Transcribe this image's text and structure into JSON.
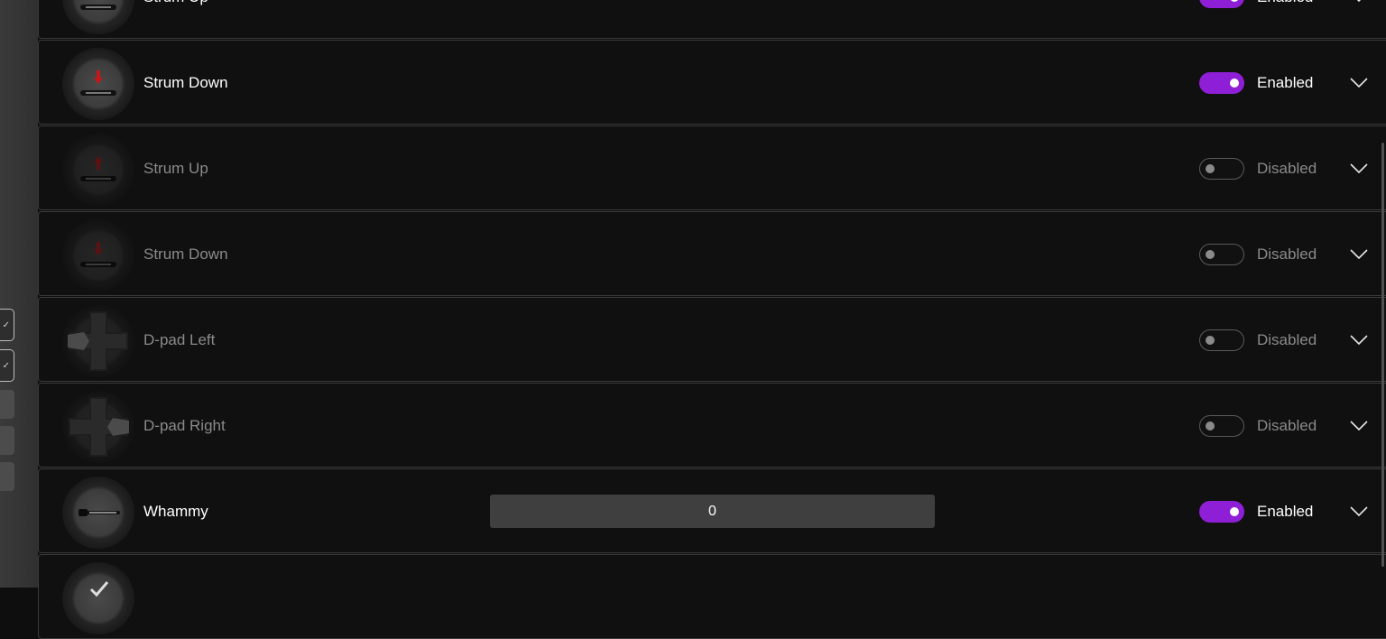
{
  "rows": [
    {
      "label": "Strum Up",
      "status": "Enabled",
      "enabled": true,
      "icon": "strum-up"
    },
    {
      "label": "Strum Down",
      "status": "Enabled",
      "enabled": true,
      "icon": "strum-down"
    },
    {
      "label": "Strum Up",
      "status": "Disabled",
      "enabled": false,
      "icon": "strum-up"
    },
    {
      "label": "Strum Down",
      "status": "Disabled",
      "enabled": false,
      "icon": "strum-down"
    },
    {
      "label": "D-pad Left",
      "status": "Disabled",
      "enabled": false,
      "icon": "dpad-left"
    },
    {
      "label": "D-pad Right",
      "status": "Disabled",
      "enabled": false,
      "icon": "dpad-right"
    },
    {
      "label": "Whammy",
      "status": "Enabled",
      "enabled": true,
      "icon": "whammy",
      "value": "0"
    },
    {
      "label": "",
      "status": "",
      "enabled": true,
      "icon": "tilt"
    }
  ],
  "colors": {
    "accent": "#8f1fd6",
    "arrow": "#c41818",
    "background": "#0e0e0e"
  }
}
